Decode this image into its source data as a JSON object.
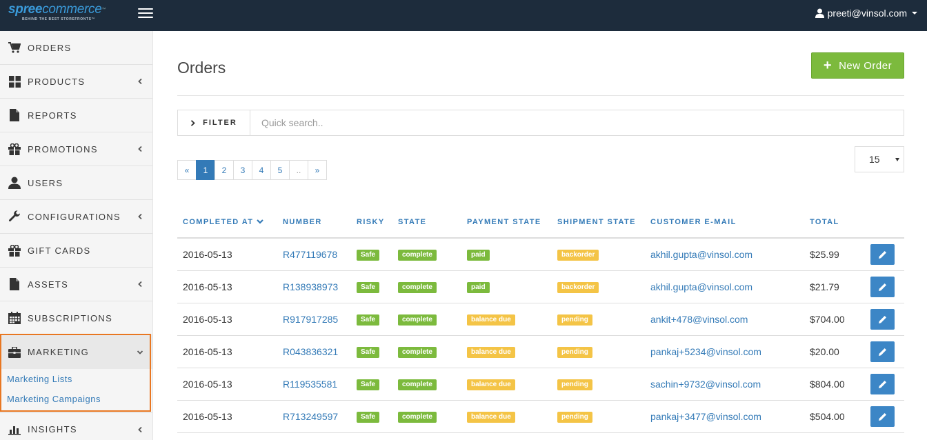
{
  "brand": {
    "logo_word_a": "spree",
    "logo_word_b": "commerce",
    "logo_tm": "™",
    "logo_tagline": "BEHIND THE BEST STOREFRONTS™"
  },
  "topbar": {
    "user_email": "preeti@vinsol.com"
  },
  "sidebar": {
    "items": [
      {
        "label": "ORDERS",
        "icon": "cart-icon",
        "chevron": false
      },
      {
        "label": "PRODUCTS",
        "icon": "grid-icon",
        "chevron": true
      },
      {
        "label": "REPORTS",
        "icon": "file-icon",
        "chevron": false
      },
      {
        "label": "PROMOTIONS",
        "icon": "gift-icon",
        "chevron": true
      },
      {
        "label": "USERS",
        "icon": "user-icon",
        "chevron": false
      },
      {
        "label": "CONFIGURATIONS",
        "icon": "wrench-icon",
        "chevron": true
      },
      {
        "label": "GIFT CARDS",
        "icon": "gift-icon",
        "chevron": false
      },
      {
        "label": "ASSETS",
        "icon": "file-icon",
        "chevron": true
      },
      {
        "label": "SUBSCRIPTIONS",
        "icon": "calendar-icon",
        "chevron": false
      },
      {
        "label": "MARKETING",
        "icon": "briefcase-icon",
        "chevron": true
      },
      {
        "label": "INSIGHTS",
        "icon": "bar-chart-icon",
        "chevron": true
      }
    ],
    "marketing_sub": [
      "Marketing Lists",
      "Marketing Campaigns"
    ],
    "highlight_color": "#e87722"
  },
  "main": {
    "title": "Orders",
    "new_order_label": "New Order",
    "filter_label": "FILTER",
    "search_placeholder": "Quick search..",
    "pagination": [
      "«",
      "1",
      "2",
      "3",
      "4",
      "5",
      "..",
      "»"
    ],
    "active_page": "1",
    "per_page": "15",
    "columns": [
      "COMPLETED AT",
      "NUMBER",
      "RISKY",
      "STATE",
      "PAYMENT STATE",
      "SHIPMENT STATE",
      "CUSTOMER E-MAIL",
      "TOTAL"
    ],
    "rows": [
      {
        "completed_at": "2016-05-13",
        "number": "R477119678",
        "risky": "Safe",
        "state": "complete",
        "payment": "paid",
        "shipment": "backorder",
        "email": "akhil.gupta@vinsol.com",
        "total": "$25.99"
      },
      {
        "completed_at": "2016-05-13",
        "number": "R138938973",
        "risky": "Safe",
        "state": "complete",
        "payment": "paid",
        "shipment": "backorder",
        "email": "akhil.gupta@vinsol.com",
        "total": "$21.79"
      },
      {
        "completed_at": "2016-05-13",
        "number": "R917917285",
        "risky": "Safe",
        "state": "complete",
        "payment": "balance due",
        "shipment": "pending",
        "email": "ankit+478@vinsol.com",
        "total": "$704.00"
      },
      {
        "completed_at": "2016-05-13",
        "number": "R043836321",
        "risky": "Safe",
        "state": "complete",
        "payment": "balance due",
        "shipment": "pending",
        "email": "pankaj+5234@vinsol.com",
        "total": "$20.00"
      },
      {
        "completed_at": "2016-05-13",
        "number": "R119535581",
        "risky": "Safe",
        "state": "complete",
        "payment": "balance due",
        "shipment": "pending",
        "email": "sachin+9732@vinsol.com",
        "total": "$804.00"
      },
      {
        "completed_at": "2016-05-13",
        "number": "R713249597",
        "risky": "Safe",
        "state": "complete",
        "payment": "balance due",
        "shipment": "pending",
        "email": "pankaj+3477@vinsol.com",
        "total": "$504.00"
      }
    ]
  },
  "colors": {
    "topbar": "#1d2c3c",
    "primary": "#337ab7",
    "success": "#7cba3d",
    "warning": "#f4c446"
  }
}
